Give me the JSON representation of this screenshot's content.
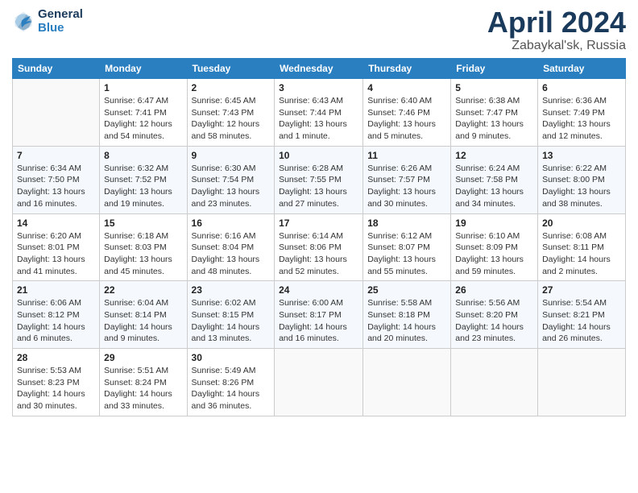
{
  "logo": {
    "line1": "General",
    "line2": "Blue"
  },
  "title": {
    "month": "April 2024",
    "location": "Zabaykal'sk, Russia"
  },
  "weekdays": [
    "Sunday",
    "Monday",
    "Tuesday",
    "Wednesday",
    "Thursday",
    "Friday",
    "Saturday"
  ],
  "weeks": [
    [
      {
        "day": "",
        "info": ""
      },
      {
        "day": "1",
        "info": "Sunrise: 6:47 AM\nSunset: 7:41 PM\nDaylight: 12 hours\nand 54 minutes."
      },
      {
        "day": "2",
        "info": "Sunrise: 6:45 AM\nSunset: 7:43 PM\nDaylight: 12 hours\nand 58 minutes."
      },
      {
        "day": "3",
        "info": "Sunrise: 6:43 AM\nSunset: 7:44 PM\nDaylight: 13 hours\nand 1 minute."
      },
      {
        "day": "4",
        "info": "Sunrise: 6:40 AM\nSunset: 7:46 PM\nDaylight: 13 hours\nand 5 minutes."
      },
      {
        "day": "5",
        "info": "Sunrise: 6:38 AM\nSunset: 7:47 PM\nDaylight: 13 hours\nand 9 minutes."
      },
      {
        "day": "6",
        "info": "Sunrise: 6:36 AM\nSunset: 7:49 PM\nDaylight: 13 hours\nand 12 minutes."
      }
    ],
    [
      {
        "day": "7",
        "info": "Sunrise: 6:34 AM\nSunset: 7:50 PM\nDaylight: 13 hours\nand 16 minutes."
      },
      {
        "day": "8",
        "info": "Sunrise: 6:32 AM\nSunset: 7:52 PM\nDaylight: 13 hours\nand 19 minutes."
      },
      {
        "day": "9",
        "info": "Sunrise: 6:30 AM\nSunset: 7:54 PM\nDaylight: 13 hours\nand 23 minutes."
      },
      {
        "day": "10",
        "info": "Sunrise: 6:28 AM\nSunset: 7:55 PM\nDaylight: 13 hours\nand 27 minutes."
      },
      {
        "day": "11",
        "info": "Sunrise: 6:26 AM\nSunset: 7:57 PM\nDaylight: 13 hours\nand 30 minutes."
      },
      {
        "day": "12",
        "info": "Sunrise: 6:24 AM\nSunset: 7:58 PM\nDaylight: 13 hours\nand 34 minutes."
      },
      {
        "day": "13",
        "info": "Sunrise: 6:22 AM\nSunset: 8:00 PM\nDaylight: 13 hours\nand 38 minutes."
      }
    ],
    [
      {
        "day": "14",
        "info": "Sunrise: 6:20 AM\nSunset: 8:01 PM\nDaylight: 13 hours\nand 41 minutes."
      },
      {
        "day": "15",
        "info": "Sunrise: 6:18 AM\nSunset: 8:03 PM\nDaylight: 13 hours\nand 45 minutes."
      },
      {
        "day": "16",
        "info": "Sunrise: 6:16 AM\nSunset: 8:04 PM\nDaylight: 13 hours\nand 48 minutes."
      },
      {
        "day": "17",
        "info": "Sunrise: 6:14 AM\nSunset: 8:06 PM\nDaylight: 13 hours\nand 52 minutes."
      },
      {
        "day": "18",
        "info": "Sunrise: 6:12 AM\nSunset: 8:07 PM\nDaylight: 13 hours\nand 55 minutes."
      },
      {
        "day": "19",
        "info": "Sunrise: 6:10 AM\nSunset: 8:09 PM\nDaylight: 13 hours\nand 59 minutes."
      },
      {
        "day": "20",
        "info": "Sunrise: 6:08 AM\nSunset: 8:11 PM\nDaylight: 14 hours\nand 2 minutes."
      }
    ],
    [
      {
        "day": "21",
        "info": "Sunrise: 6:06 AM\nSunset: 8:12 PM\nDaylight: 14 hours\nand 6 minutes."
      },
      {
        "day": "22",
        "info": "Sunrise: 6:04 AM\nSunset: 8:14 PM\nDaylight: 14 hours\nand 9 minutes."
      },
      {
        "day": "23",
        "info": "Sunrise: 6:02 AM\nSunset: 8:15 PM\nDaylight: 14 hours\nand 13 minutes."
      },
      {
        "day": "24",
        "info": "Sunrise: 6:00 AM\nSunset: 8:17 PM\nDaylight: 14 hours\nand 16 minutes."
      },
      {
        "day": "25",
        "info": "Sunrise: 5:58 AM\nSunset: 8:18 PM\nDaylight: 14 hours\nand 20 minutes."
      },
      {
        "day": "26",
        "info": "Sunrise: 5:56 AM\nSunset: 8:20 PM\nDaylight: 14 hours\nand 23 minutes."
      },
      {
        "day": "27",
        "info": "Sunrise: 5:54 AM\nSunset: 8:21 PM\nDaylight: 14 hours\nand 26 minutes."
      }
    ],
    [
      {
        "day": "28",
        "info": "Sunrise: 5:53 AM\nSunset: 8:23 PM\nDaylight: 14 hours\nand 30 minutes."
      },
      {
        "day": "29",
        "info": "Sunrise: 5:51 AM\nSunset: 8:24 PM\nDaylight: 14 hours\nand 33 minutes."
      },
      {
        "day": "30",
        "info": "Sunrise: 5:49 AM\nSunset: 8:26 PM\nDaylight: 14 hours\nand 36 minutes."
      },
      {
        "day": "",
        "info": ""
      },
      {
        "day": "",
        "info": ""
      },
      {
        "day": "",
        "info": ""
      },
      {
        "day": "",
        "info": ""
      }
    ]
  ]
}
